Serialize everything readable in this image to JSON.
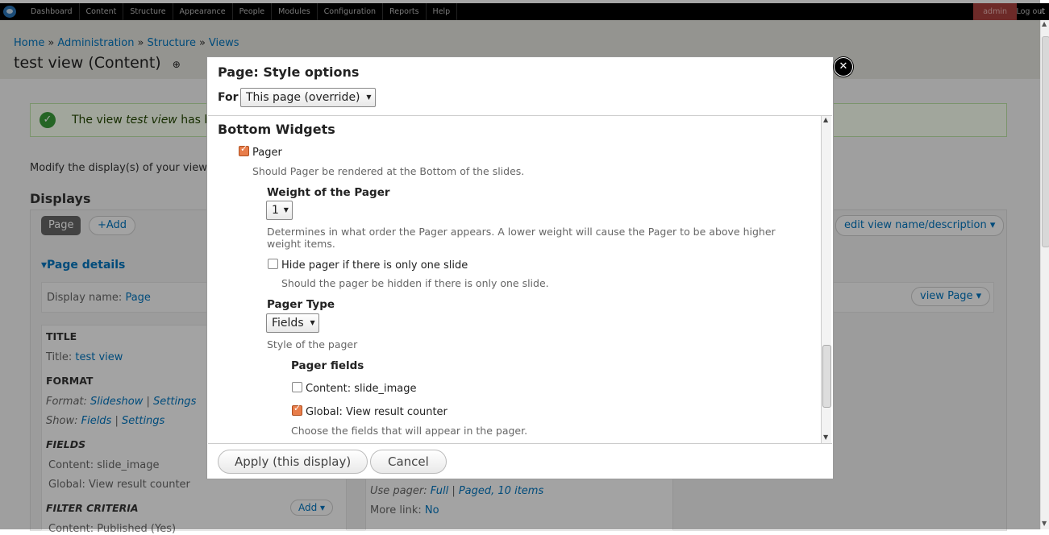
{
  "toolbar": {
    "menu": [
      "Dashboard",
      "Content",
      "Structure",
      "Appearance",
      "People",
      "Modules",
      "Configuration",
      "Reports",
      "Help"
    ],
    "user": "admin",
    "logout": "Log out"
  },
  "breadcrumb": [
    "Home",
    "Administration",
    "Structure",
    "Views"
  ],
  "breadcrumb_sep": "»",
  "page_title": "test view (Content)",
  "status": {
    "prefix": "The view ",
    "view": "test view",
    "suffix": " has be"
  },
  "modify_text": "Modify the display(s) of your view",
  "displays_heading": "Displays",
  "tabs": {
    "page": "Page",
    "add": "+Add",
    "edit_view": "edit view name/description ▾"
  },
  "page_details": "▾Page details",
  "display_name": {
    "label": "Display name:",
    "value": "Page"
  },
  "view_page": "view Page ▾",
  "left": {
    "title_h": "TITLE",
    "title_lbl": "Title:",
    "title_val": "test view",
    "format_h": "FORMAT",
    "format_lbl": "Format:",
    "format_val": "Slideshow",
    "format_settings": "Settings",
    "show_lbl": "Show:",
    "show_val": "Fields",
    "show_settings": "Settings",
    "fields_h": "FIELDS",
    "field1": "Content: slide_image",
    "field2": "Global: View result counter",
    "filter_h": "FILTER CRITERIA",
    "filter_add": "Add ▾",
    "filter1": "Content: Published (Yes)"
  },
  "mid": {
    "pager_lbl": "Use pager:",
    "pager_val1": "Full",
    "pager_val2": "Paged, 10 items",
    "more_lbl": "More link:",
    "more_val": "No"
  },
  "modal": {
    "title": "Page: Style options",
    "for_label": "For",
    "for_select": "This page (override)",
    "section": "Bottom Widgets",
    "pager_cb": "Pager",
    "pager_desc": "Should Pager be rendered at the Bottom of the slides.",
    "weight_h": "Weight of the Pager",
    "weight_val": "1",
    "weight_desc": "Determines in what order the Pager appears. A lower weight will cause the Pager to be above higher weight items.",
    "hide_cb": "Hide pager if there is only one slide",
    "hide_desc": "Should the pager be hidden if there is only one slide.",
    "type_h": "Pager Type",
    "type_val": "Fields",
    "type_desc": "Style of the pager",
    "fields_h": "Pager fields",
    "field1": "Content: slide_image",
    "field2": "Global: View result counter",
    "fields_desc": "Choose the fields that will appear in the pager.",
    "apply": "Apply (this display)",
    "cancel": "Cancel",
    "close": "✕"
  },
  "checkbox_states": {
    "pager": true,
    "hide": false,
    "field1": false,
    "field2": true
  }
}
